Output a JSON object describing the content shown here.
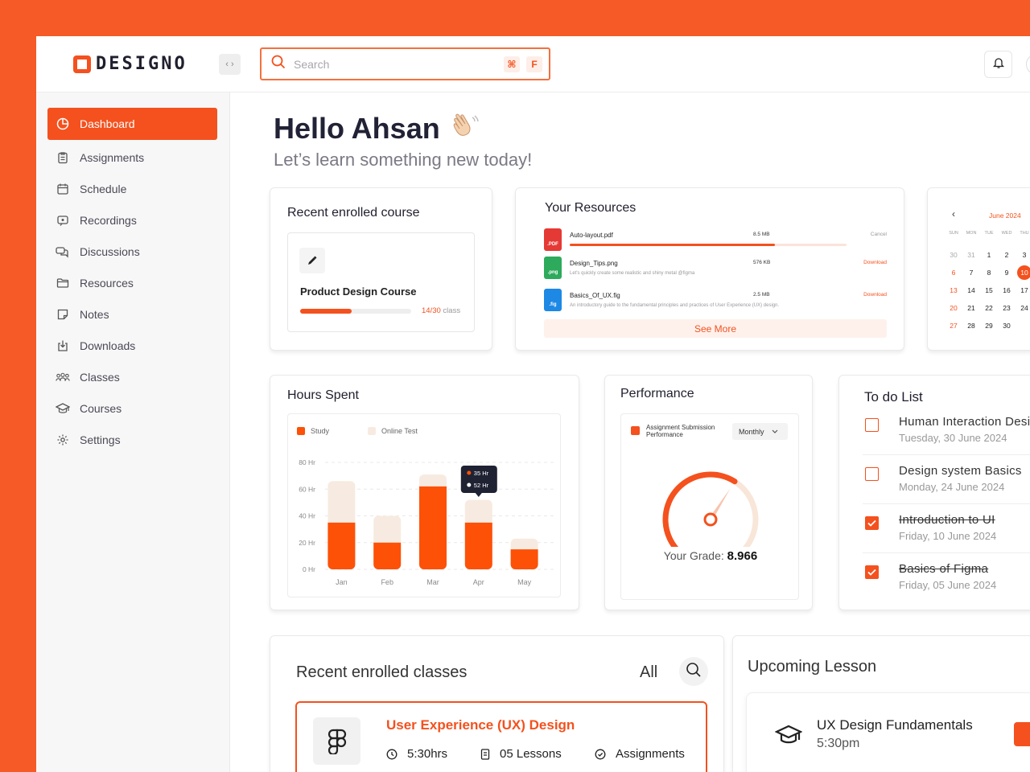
{
  "brand": {
    "name": "DESIGNO",
    "accent": "#f4511e"
  },
  "search": {
    "placeholder": "Search",
    "shortcut_key1": "⌘",
    "shortcut_key2": "F"
  },
  "sidebar": {
    "items": [
      {
        "label": "Dashboard",
        "icon": "dashboard-icon",
        "active": true
      },
      {
        "label": "Assignments",
        "icon": "clipboard-icon"
      },
      {
        "label": "Schedule",
        "icon": "calendar-icon"
      },
      {
        "label": "Recordings",
        "icon": "recording-icon"
      },
      {
        "label": "Discussions",
        "icon": "chat-icon"
      },
      {
        "label": "Resources",
        "icon": "folder-icon"
      },
      {
        "label": "Notes",
        "icon": "note-icon"
      },
      {
        "label": "Downloads",
        "icon": "download-icon"
      },
      {
        "label": "Classes",
        "icon": "people-icon"
      },
      {
        "label": "Courses",
        "icon": "graduation-cap-icon"
      },
      {
        "label": "Settings",
        "icon": "gear-icon"
      }
    ]
  },
  "greeting": {
    "title": "Hello Ahsan",
    "emoji": "👋",
    "subtitle": "Let’s learn something new today!"
  },
  "recent_course": {
    "title": "Recent enrolled course",
    "course_name": "Product Design Course",
    "progress_done": 14,
    "progress_total": 30,
    "progress_text": "14/30",
    "progress_suffix": " class"
  },
  "resources": {
    "title": "Your Resources",
    "files": [
      {
        "name": "Auto-layout.pdf",
        "size": "8.5 MB",
        "action": "Cancel",
        "type": ".PDF",
        "color": "#e53935",
        "upload_progress": 0.74,
        "desc": ""
      },
      {
        "name": "Design_Tips.png",
        "size": "576 KB",
        "action": "Download",
        "type": ".png",
        "color": "#2eaa5c",
        "desc": "Let's quickly create some realistic and shiny metal @figma"
      },
      {
        "name": "Basics_Of_UX.fig",
        "size": "2.5 MB",
        "action": "Download",
        "type": ".fig",
        "color": "#1e88e5",
        "desc": "An introductory guide to the fundamental principles and practices of User Experience (UX) design."
      }
    ],
    "see_more": "See More"
  },
  "calendar": {
    "month": "June 2024",
    "weekdays": [
      "SUN",
      "MON",
      "TUE",
      "WED",
      "THU"
    ],
    "weeks": [
      [
        "30",
        "31",
        "1",
        "2",
        "3"
      ],
      [
        "6",
        "7",
        "8",
        "9",
        "10"
      ],
      [
        "13",
        "14",
        "15",
        "16",
        "17"
      ],
      [
        "20",
        "21",
        "22",
        "23",
        "24"
      ],
      [
        "27",
        "28",
        "29",
        "30",
        ""
      ]
    ],
    "selected": "10"
  },
  "hours_spent": {
    "title": "Hours Spent",
    "legend": [
      "Study",
      "Online Test"
    ],
    "tooltip": {
      "a": "35 Hr",
      "b": "52 Hr"
    }
  },
  "chart_data": {
    "type": "bar",
    "categories": [
      "Jan",
      "Feb",
      "Mar",
      "Apr",
      "May"
    ],
    "series": [
      {
        "name": "Study",
        "values": [
          35,
          20,
          62,
          35,
          15
        ]
      },
      {
        "name": "Online Test",
        "values": [
          66,
          40,
          71,
          52,
          23
        ]
      }
    ],
    "yticks": [
      "0 Hr",
      "20 Hr",
      "40 Hr",
      "60 Hr",
      "80 Hr"
    ],
    "ylim": [
      0,
      80
    ],
    "colors": {
      "study": "#fd5108",
      "online": "#f7ebe1"
    }
  },
  "performance": {
    "title": "Performance",
    "legend": "Assignment Submission Performance",
    "dropdown": "Monthly",
    "grade_label": "Your Grade: ",
    "grade_value": "8.966",
    "gauge_fraction": 0.62
  },
  "todo": {
    "title": "To do List",
    "items": [
      {
        "title": "Human Interaction Designs",
        "date": "Tuesday, 30 June 2024",
        "done": false
      },
      {
        "title": "Design system Basics",
        "date": "Monday, 24 June 2024",
        "done": false
      },
      {
        "title": "Introduction to UI",
        "date": "Friday, 10 June 2024",
        "done": true
      },
      {
        "title": "Basics of Figma",
        "date": "Friday, 05 June 2024",
        "done": true
      }
    ]
  },
  "classes": {
    "title": "Recent enrolled classes",
    "filter": "All",
    "items": [
      {
        "name": "User Experience (UX) Design",
        "duration": "5:30hrs",
        "lessons": "05 Lessons",
        "assignments": "Assignments"
      }
    ]
  },
  "upcoming": {
    "title": "Upcoming Lesson",
    "items": [
      {
        "name": "UX Design Fundamentals",
        "time": "5:30pm"
      }
    ]
  }
}
